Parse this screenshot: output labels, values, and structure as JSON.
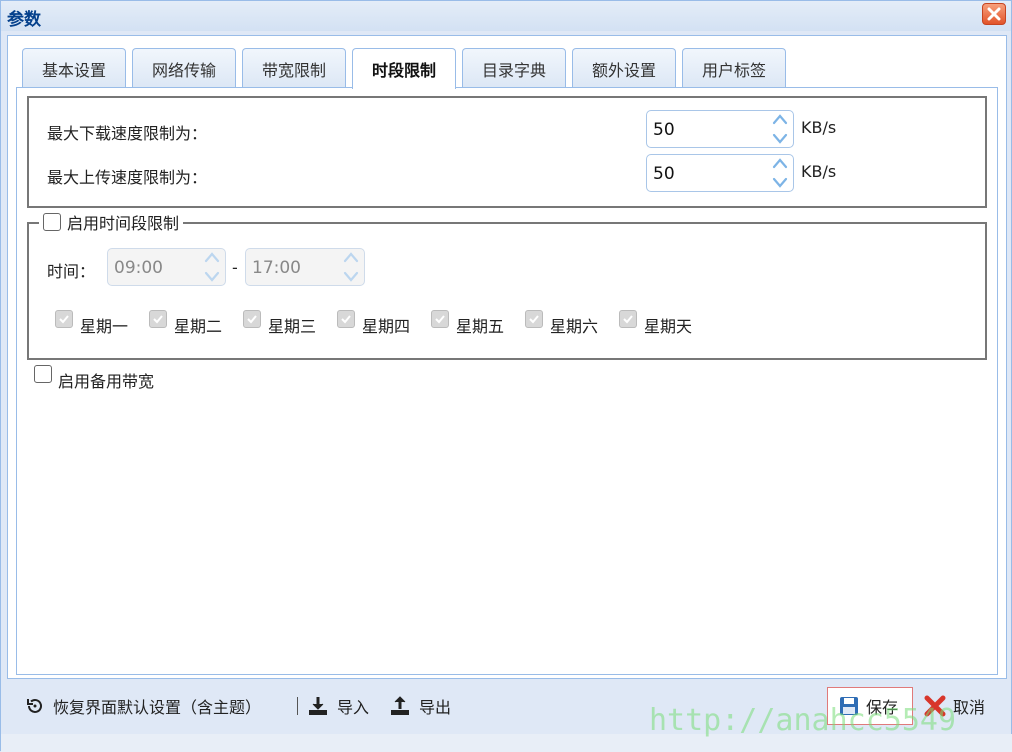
{
  "window": {
    "title": "参数"
  },
  "tabs": [
    {
      "label": "基本设置",
      "active": false
    },
    {
      "label": "网络传输",
      "active": false
    },
    {
      "label": "带宽限制",
      "active": false
    },
    {
      "label": "时段限制",
      "active": true
    },
    {
      "label": "目录字典",
      "active": false
    },
    {
      "label": "额外设置",
      "active": false
    },
    {
      "label": "用户标签",
      "active": false
    }
  ],
  "speed_limits": {
    "download_label": "最大下载速度限制为：",
    "download_value": "50",
    "upload_label": "最大上传速度限制为：",
    "upload_value": "50",
    "unit": "KB/s"
  },
  "schedule": {
    "enable_label": "启用时间段限制",
    "enabled": false,
    "time_label": "时间：",
    "start_time": "09:00",
    "separator": "-",
    "end_time": "17:00",
    "days": [
      {
        "label": "星期一",
        "checked": true
      },
      {
        "label": "星期二",
        "checked": true
      },
      {
        "label": "星期三",
        "checked": true
      },
      {
        "label": "星期四",
        "checked": true
      },
      {
        "label": "星期五",
        "checked": true
      },
      {
        "label": "星期六",
        "checked": true
      },
      {
        "label": "星期天",
        "checked": true
      }
    ]
  },
  "backup_bandwidth": {
    "label": "启用备用带宽",
    "enabled": false
  },
  "footer": {
    "restore_label": "恢复界面默认设置（含主题）",
    "import_label": "导入",
    "export_label": "导出",
    "save_label": "保存",
    "cancel_label": "取消"
  },
  "watermark": "http://anahcc5549",
  "colors": {
    "title": "#04408c",
    "border": "#99bce8",
    "close": "#e2542a",
    "save_border": "#e07a7a"
  }
}
